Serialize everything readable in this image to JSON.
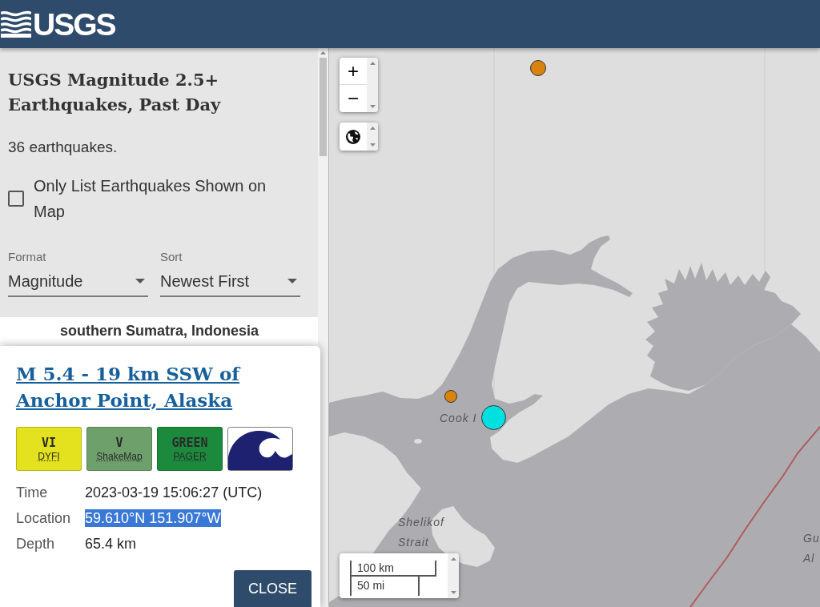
{
  "header": {
    "logo_text": "USGS"
  },
  "sidebar": {
    "title": "USGS Magnitude 2.5+ Earthquakes, Past Day",
    "count": "36 earthquakes.",
    "filter_checkbox": {
      "label": "Only List Earthquakes Shown on Map",
      "checked": false
    },
    "selects": [
      {
        "label": "Format",
        "value": "Magnitude"
      },
      {
        "label": "Sort",
        "value": "Newest First"
      }
    ],
    "list_items": [
      {
        "title": "southern Sumatra, Indonesia"
      }
    ]
  },
  "popup": {
    "title": "M 5.4 - 19 km SSW of Anchor Point, Alaska",
    "products": [
      {
        "kind": "intensity",
        "value": "VI",
        "label": "DYFI",
        "color": "#e4e11f"
      },
      {
        "kind": "intensity",
        "value": "V",
        "label": "ShakeMap",
        "color": "#6ea06c"
      },
      {
        "kind": "intensity",
        "value": "GREEN",
        "label": "PAGER",
        "color": "#1c8a3c"
      },
      {
        "kind": "tsunami"
      }
    ],
    "details": [
      {
        "label": "Time",
        "value": "2023-03-19 15:06:27 (UTC)",
        "highlighted": false
      },
      {
        "label": "Location",
        "value": "59.610°N 151.907°W",
        "highlighted": true
      },
      {
        "label": "Depth",
        "value": "65.4 km",
        "highlighted": false
      }
    ],
    "close_button": "CLOSE"
  },
  "map": {
    "zoom_in": "+",
    "zoom_out": "−",
    "markers": [
      {
        "kind": "medium",
        "color": "#d9830f"
      },
      {
        "kind": "small",
        "color": "#d9830f"
      },
      {
        "kind": "large",
        "color": "#00e0e0"
      }
    ],
    "labels": [
      {
        "lines": [
          "Cook I"
        ]
      },
      {
        "lines": [
          "Shelikof",
          "Strait"
        ]
      },
      {
        "lines": [
          "Gu",
          "Al"
        ]
      }
    ],
    "scale": [
      "100 km",
      "50 mi"
    ]
  }
}
